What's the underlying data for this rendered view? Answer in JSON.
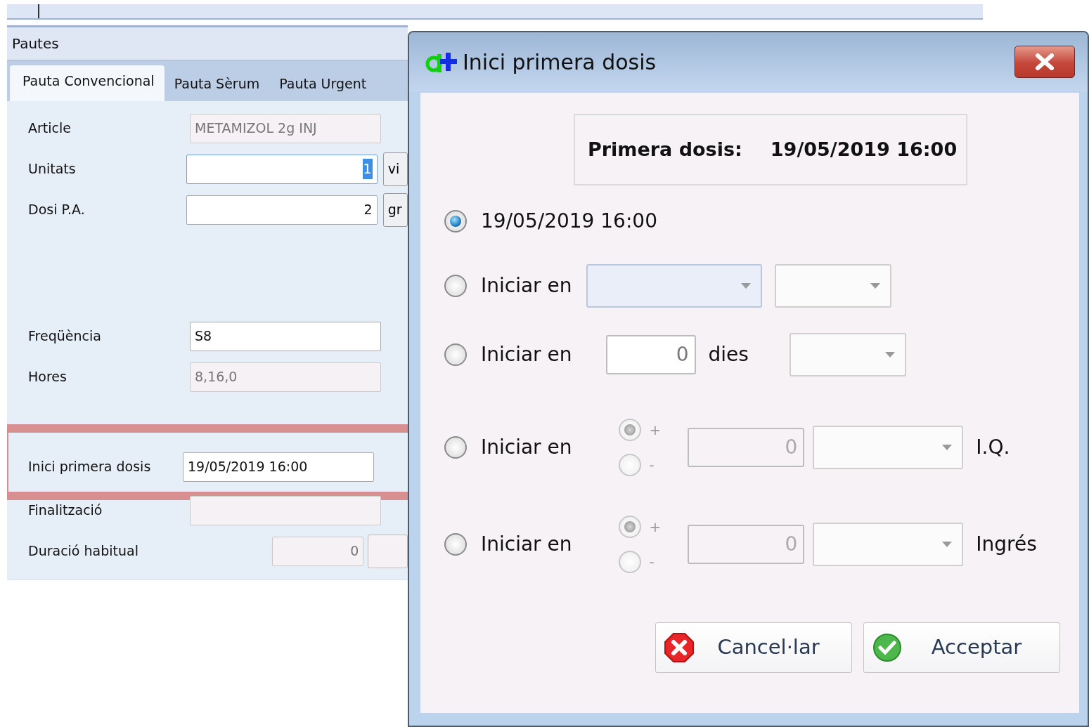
{
  "background_window": {
    "section_title": "Pautes",
    "tabs": [
      {
        "label": "Pauta Convencional",
        "selected": true
      },
      {
        "label": "Pauta Sèrum",
        "selected": false
      },
      {
        "label": "Pauta Urgent",
        "selected": false
      }
    ],
    "fields": [
      {
        "kind": "text",
        "label": "Article",
        "value": "METAMIZOL 2g INJ",
        "disabled": true
      },
      {
        "kind": "number",
        "label": "Unitats",
        "value": "1",
        "unit_button": "vi",
        "focused": true
      },
      {
        "kind": "number",
        "label": "Dosi P.A.",
        "value": "2",
        "unit_button": "gr"
      },
      {
        "kind": "text",
        "label": "Freqüència",
        "value": "S8",
        "gap_before": true
      },
      {
        "kind": "text",
        "label": "Hores",
        "value": "8,16,0",
        "disabled": true
      },
      {
        "kind": "text",
        "label": "Inici primera dosis",
        "value": "19/05/2019 16:00",
        "highlighted": true
      },
      {
        "kind": "text",
        "label": "Finalització",
        "disabled": true
      },
      {
        "kind": "short_number",
        "label": "Duració habitual",
        "value": "0",
        "disabled": true
      }
    ]
  },
  "dialog": {
    "title": "Inici primera dosis",
    "summary": {
      "label": "Primera dosis:",
      "value": "19/05/2019 16:00"
    },
    "options": [
      {
        "kind": "date",
        "label": "19/05/2019 16:00",
        "selected": true
      },
      {
        "kind": "dropdowns",
        "label": "Iniciar en",
        "selected": false
      },
      {
        "kind": "days",
        "label": "Iniciar en",
        "value": "0",
        "unit": "dies",
        "selected": false
      },
      {
        "kind": "offset",
        "label": "Iniciar en",
        "signs": [
          {
            "label": "+",
            "selected": true
          },
          {
            "label": "-",
            "selected": false
          }
        ],
        "value": "0",
        "suffix": "I.Q.",
        "selected": false
      },
      {
        "kind": "offset",
        "label": "Iniciar en",
        "signs": [
          {
            "label": "+",
            "selected": true
          },
          {
            "label": "-",
            "selected": false
          }
        ],
        "value": "0",
        "suffix": "Ingrés",
        "selected": false
      }
    ],
    "buttons": [
      {
        "kind": "cancel",
        "label": "Cancel·lar"
      },
      {
        "kind": "accept",
        "label": "Acceptar"
      }
    ]
  }
}
